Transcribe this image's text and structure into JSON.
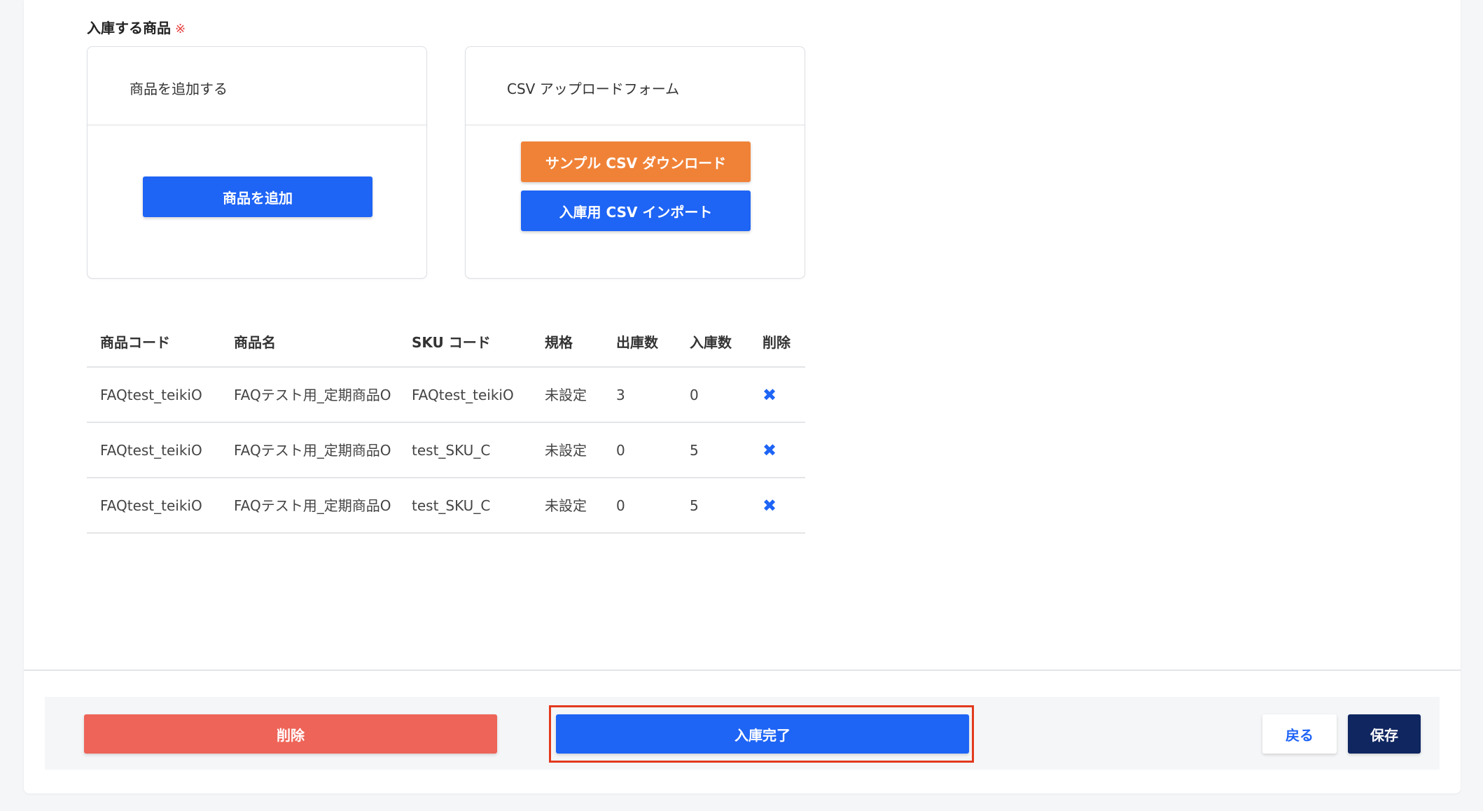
{
  "section": {
    "title": "入庫する商品",
    "required_mark": "※"
  },
  "add_card": {
    "header": "商品を追加する",
    "add_button": "商品を追加"
  },
  "csv_card": {
    "header": "CSV アップロードフォーム",
    "sample_button": "サンプル CSV ダウンロード",
    "import_button": "入庫用 CSV インポート"
  },
  "table": {
    "columns": [
      "商品コード",
      "商品名",
      "SKU コード",
      "規格",
      "出庫数",
      "入庫数",
      "削除"
    ],
    "rows": [
      {
        "code": "FAQtest_teikiO",
        "name": "FAQテスト用_定期商品O",
        "sku": "FAQtest_teikiO",
        "spec": "未設定",
        "out": "3",
        "in": "0",
        "delete": "✖"
      },
      {
        "code": "FAQtest_teikiO",
        "name": "FAQテスト用_定期商品O",
        "sku": "test_SKU_C",
        "spec": "未設定",
        "out": "0",
        "in": "5",
        "delete": "✖"
      },
      {
        "code": "FAQtest_teikiO",
        "name": "FAQテスト用_定期商品O",
        "sku": "test_SKU_C",
        "spec": "未設定",
        "out": "0",
        "in": "5",
        "delete": "✖"
      }
    ]
  },
  "footer": {
    "delete_label": "削除",
    "complete_label": "入庫完了",
    "back_label": "戻る",
    "save_label": "保存"
  },
  "colors": {
    "primary": "#1e64f5",
    "orange": "#f08237",
    "danger": "#ee6458",
    "navy": "#0f2660",
    "highlight": "#e23a1e"
  }
}
